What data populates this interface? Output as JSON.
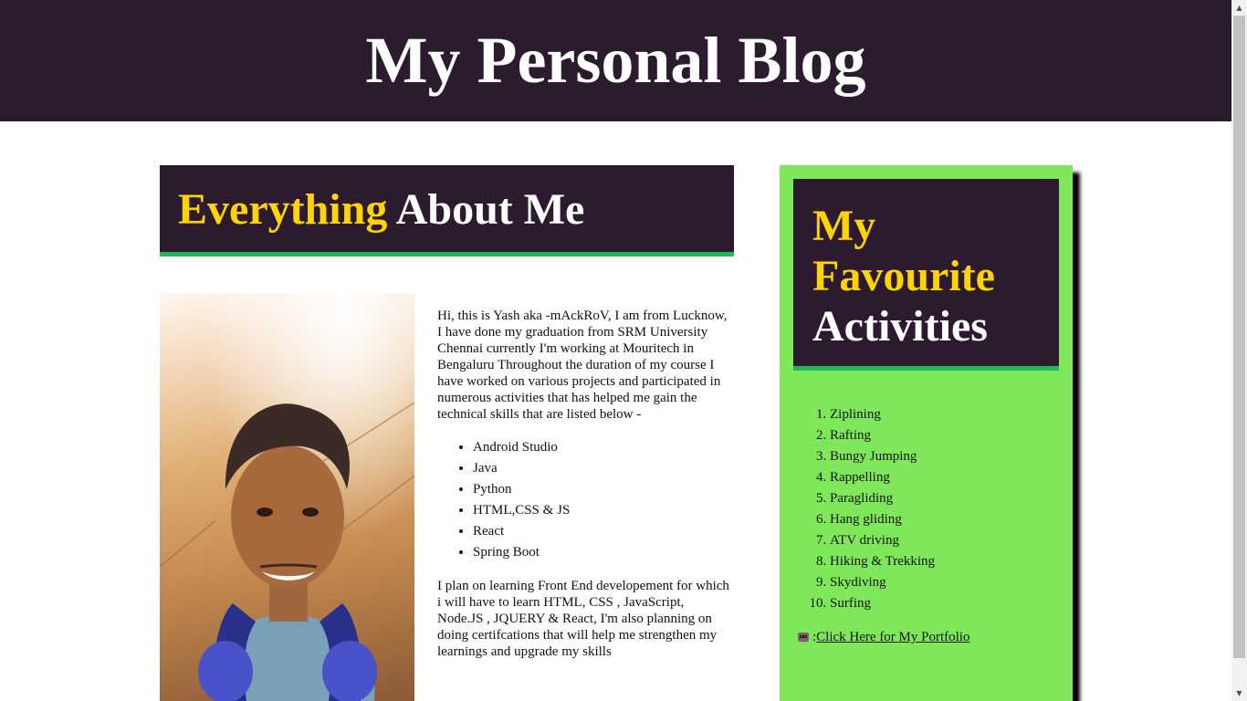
{
  "header": {
    "title": "My Personal Blog"
  },
  "about": {
    "title_highlight": "Everything",
    "title_rest": "About Me",
    "intro": "Hi, this is Yash aka -mAckRoV, I am from Lucknow, I have done my graduation from SRM University Chennai currently I'm working at Mouritech in Bengaluru Throughout the duration of my course I have worked on various projects and participated in numerous activities that has helped me gain the technical skills that are listed below -",
    "skills": [
      "Android Studio",
      "Java",
      "Python",
      "HTML,CSS & JS",
      "React",
      "Spring Boot"
    ],
    "plans": "I plan on learning Front End developement for which i will have to learn HTML, CSS , JavaScript, Node.JS , JQUERY & React, I'm also planning on doing certifcations that will help me strengthen my learnings and upgrade my skills"
  },
  "sidebar": {
    "title_line1": "My",
    "title_line2": "Favourite",
    "title_line3": "Activities",
    "activities": [
      "Ziplining",
      "Rafting",
      "Bungy Jumping",
      "Rappelling",
      "Paragliding",
      "Hang gliding",
      "ATV driving",
      "Hiking & Trekking",
      "Skydiving",
      "Surfing"
    ],
    "portfolio_prefix": ":",
    "portfolio_link": "Click Here for My Portfolio",
    "portfolio_icon": "robot-icon"
  },
  "colors": {
    "header_bg": "#2c1b2e",
    "highlight": "#ffd400",
    "accent_border": "#1db954",
    "sidebar_bg": "#7ee85a"
  }
}
